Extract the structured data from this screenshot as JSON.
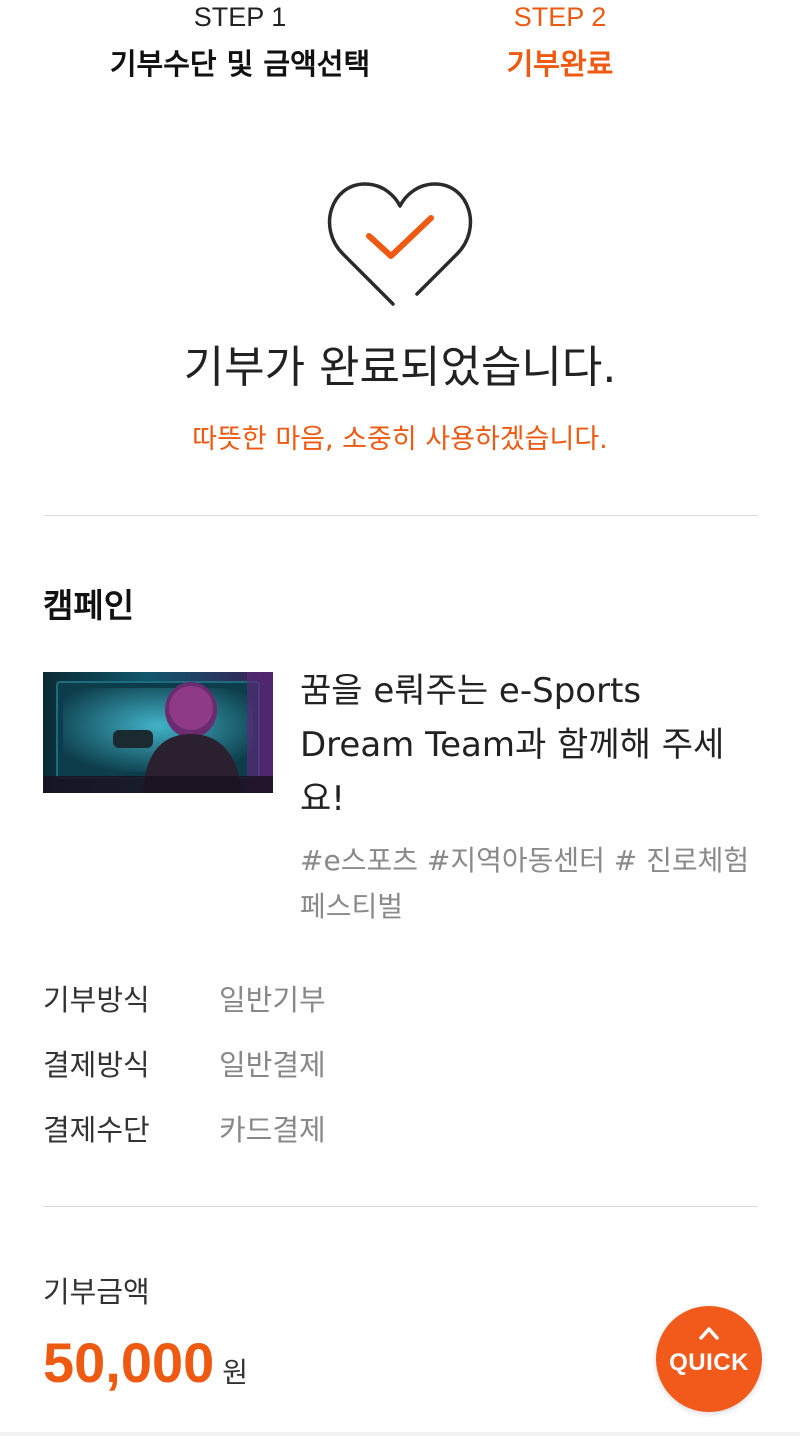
{
  "steps": [
    {
      "num": "STEP 1",
      "title": "기부수단 및 금액선택",
      "active": false
    },
    {
      "num": "STEP 2",
      "title": "기부완료",
      "active": true
    }
  ],
  "complete": {
    "icon": "heart-check-icon",
    "title": "기부가 완료되었습니다.",
    "subtitle": "따뜻한 마음, 소중히 사용하겠습니다."
  },
  "campaign": {
    "section_label": "캠페인",
    "thumbnail_icon": "campaign-thumbnail",
    "title": "꿈을 e뤄주는 e-Sports Dream Team과 함께해 주세요!",
    "tags": "#e스포츠 #지역아동센터 # 진로체험페스티벌"
  },
  "details": [
    {
      "label": "기부방식",
      "value": "일반기부"
    },
    {
      "label": "결제방식",
      "value": "일반결제"
    },
    {
      "label": "결제수단",
      "value": "카드결제"
    }
  ],
  "amount": {
    "label": "기부금액",
    "value": "50,000",
    "unit": "원"
  },
  "quick": {
    "label": "QUICK",
    "icon": "chevron-up-icon"
  },
  "colors": {
    "accent": "#ee5a12",
    "quick_bg": "#f25a1c",
    "text": "#222222",
    "muted": "#888888"
  }
}
